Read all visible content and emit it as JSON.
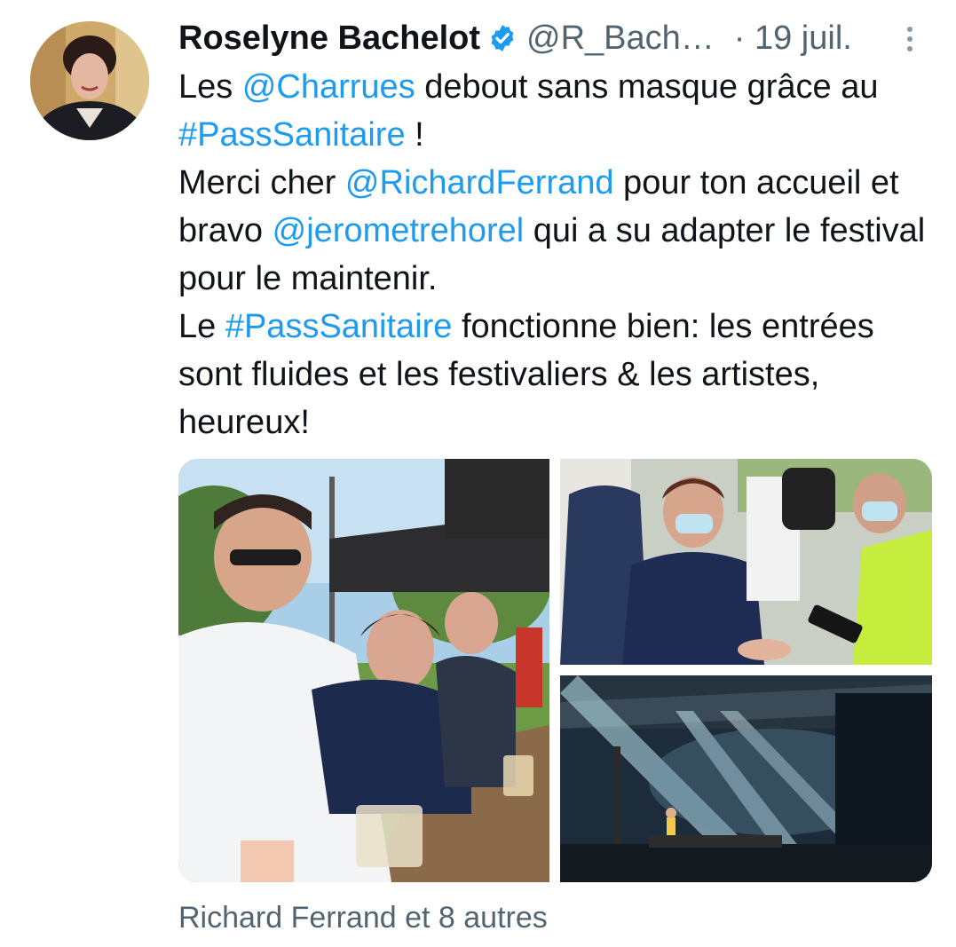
{
  "tweet": {
    "author_name": "Roselyne Bachelot",
    "handle": "@R_Bach…",
    "date": "· 19 juil.",
    "verified_icon": "verified-badge-icon",
    "more_icon": "more-vertical-icon",
    "text_segments": [
      {
        "t": "Les "
      },
      {
        "t": "@Charrues",
        "link": true
      },
      {
        "t": " debout sans masque grâce au "
      },
      {
        "t": "#PassSanitaire",
        "link": true
      },
      {
        "t": " !"
      },
      {
        "br": true
      },
      {
        "t": "Merci cher "
      },
      {
        "t": "@RichardFerrand",
        "link": true
      },
      {
        "t": " pour ton accueil et bravo "
      },
      {
        "t": "@jerometrehorel",
        "link": true
      },
      {
        "t": " qui a su adapter le festival pour le maintenir."
      },
      {
        "br": true
      },
      {
        "t": "Le "
      },
      {
        "t": "#PassSanitaire",
        "link": true
      },
      {
        "t": " fonctionne bien: les entrées sont fluides et les festivaliers & les artistes, heureux!"
      }
    ],
    "photos": [
      {
        "name": "photo-terrace"
      },
      {
        "name": "photo-pass-check"
      },
      {
        "name": "photo-concert-stage"
      }
    ],
    "likes_summary": "Richard Ferrand et 8 autres"
  },
  "colors": {
    "link": "#1d9bf0",
    "secondary_text": "#536471",
    "primary_text": "#0f1419"
  }
}
